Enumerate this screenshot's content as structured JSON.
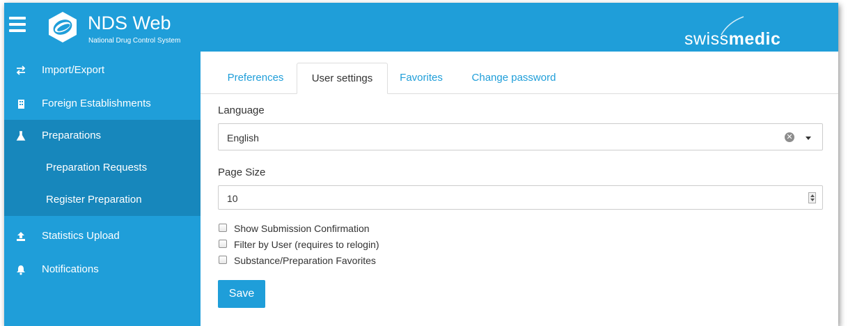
{
  "header": {
    "title": "NDS Web",
    "subtitle": "National Drug Control System",
    "brand_light": "swiss",
    "brand_bold": "medic"
  },
  "sidebar": {
    "items": [
      {
        "label": "Import/Export",
        "icon": "exchange-icon"
      },
      {
        "label": "Foreign Establishments",
        "icon": "building-icon"
      },
      {
        "label": "Preparations",
        "icon": "flask-icon"
      },
      {
        "label": "Preparation Requests"
      },
      {
        "label": "Register Preparation"
      },
      {
        "label": "Statistics Upload",
        "icon": "upload-icon"
      },
      {
        "label": "Notifications",
        "icon": "bell-icon"
      }
    ]
  },
  "tabs": [
    {
      "label": "Preferences"
    },
    {
      "label": "User settings",
      "active": true
    },
    {
      "label": "Favorites"
    },
    {
      "label": "Change password"
    }
  ],
  "form": {
    "language_label": "Language",
    "language_value": "English",
    "page_size_label": "Page Size",
    "page_size_value": "10",
    "checkboxes": [
      {
        "label": "Show Submission Confirmation",
        "checked": false
      },
      {
        "label": "Filter by User (requires to relogin)",
        "checked": false
      },
      {
        "label": "Substance/Preparation Favorites",
        "checked": false
      }
    ],
    "save_label": "Save"
  },
  "colors": {
    "primary": "#1f9ed9",
    "sidebar_active": "#1787bc"
  }
}
